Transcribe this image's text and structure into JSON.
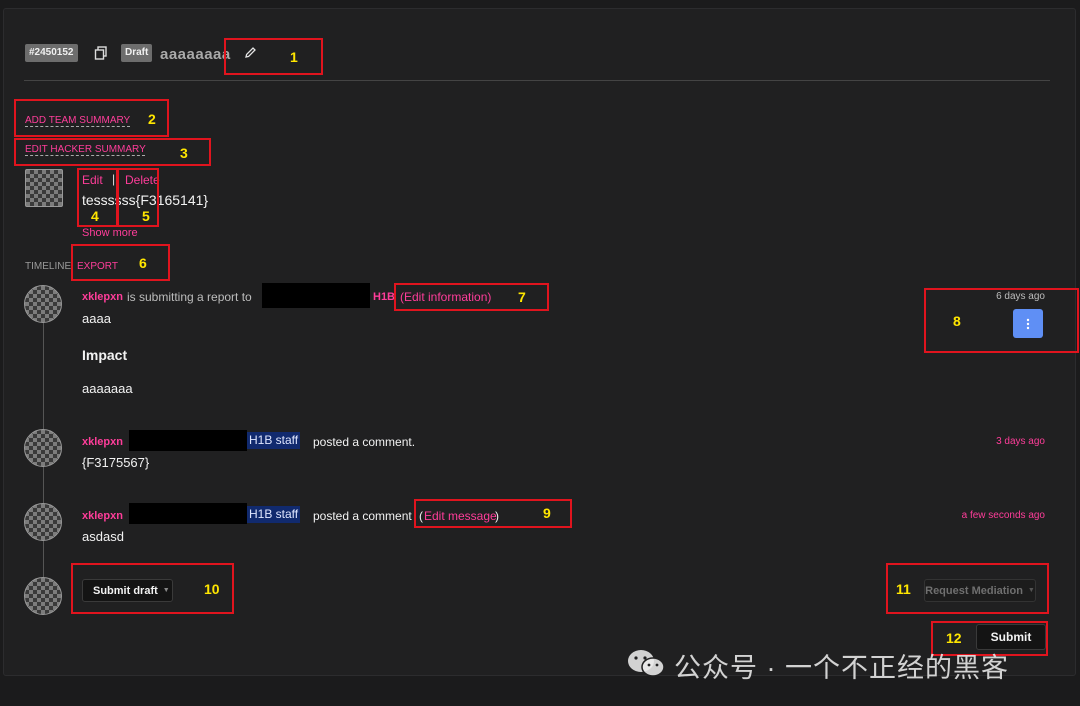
{
  "header": {
    "report_id": "#2450152",
    "status_badge": "Draft",
    "report_title": "aaaaaaaa"
  },
  "summary_links": {
    "add_team_summary": "ADD TEAM SUMMARY",
    "edit_hacker_summary": "EDIT HACKER SUMMARY"
  },
  "hacker_summary": {
    "edit": "Edit",
    "separator": "|",
    "delete": "Delete",
    "text": "tessssss{F3165141}",
    "show_more": "Show more"
  },
  "timeline": {
    "label": "TIMELINE",
    "export": "EXPORT",
    "entries": [
      {
        "user": "xklepxn",
        "action": "is submitting a report to",
        "program_suffix": "H1B",
        "edit_link": "(Edit information)",
        "time": "6 days ago",
        "body_line1": "aaaa",
        "heading": "Impact",
        "body_line2": "aaaaaaa"
      },
      {
        "user": "xklepxn",
        "staff_badge": "H1B staff",
        "action": "posted a comment.",
        "time": "3 days ago",
        "body": "{F3175567}"
      },
      {
        "user": "xklepxn",
        "staff_badge": "H1B staff",
        "action": "posted a comment",
        "edit_open": "(",
        "edit_link": "Edit message",
        "edit_close": ")",
        "time": "a few seconds ago",
        "body": "asdasd"
      }
    ]
  },
  "actions": {
    "submit_draft": "Submit draft",
    "request_mediation": "Request Mediation",
    "submit": "Submit"
  },
  "annotations": [
    "1",
    "2",
    "3",
    "4",
    "5",
    "6",
    "7",
    "8",
    "9",
    "10",
    "11",
    "12"
  ],
  "watermark": "公众号 · 一个不正经的黑客",
  "colors": {
    "accent_pink": "#ff3d9a",
    "annotation_red": "#e0141e",
    "annotation_yellow": "#ffe600",
    "menu_button_blue": "#5f8ff5",
    "staff_badge_bg": "#112a6e"
  }
}
